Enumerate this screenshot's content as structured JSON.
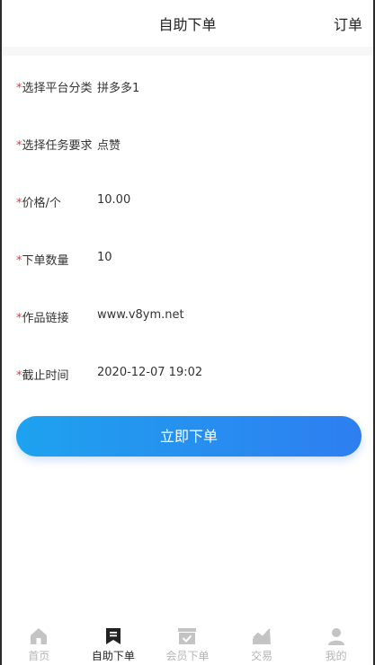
{
  "header": {
    "title": "自助下单",
    "right": "订单"
  },
  "form": {
    "fields": [
      {
        "label": "选择平台分类",
        "value": "拼多多1"
      },
      {
        "label": "选择任务要求",
        "value": "点赞"
      },
      {
        "label": "价格/个",
        "value": "10.00"
      },
      {
        "label": "下单数量",
        "value": "10"
      },
      {
        "label": "作品链接",
        "value": "www.v8ym.net"
      },
      {
        "label": "截止时间",
        "value": "2020-12-07 19:02"
      }
    ],
    "required_mark": "*",
    "submit_label": "立即下单"
  },
  "tabbar": {
    "tabs": [
      {
        "label": "首页",
        "icon": "home-icon"
      },
      {
        "label": "自助下单",
        "icon": "bookmark-icon"
      },
      {
        "label": "会员下单",
        "icon": "checkbox-card-icon"
      },
      {
        "label": "交易",
        "icon": "trend-chart-icon"
      },
      {
        "label": "我的",
        "icon": "user-icon"
      }
    ],
    "active_index": 1
  },
  "colors": {
    "accent_start": "#1ea2ef",
    "accent_end": "#2e7ef0",
    "required": "#e53b3b"
  }
}
